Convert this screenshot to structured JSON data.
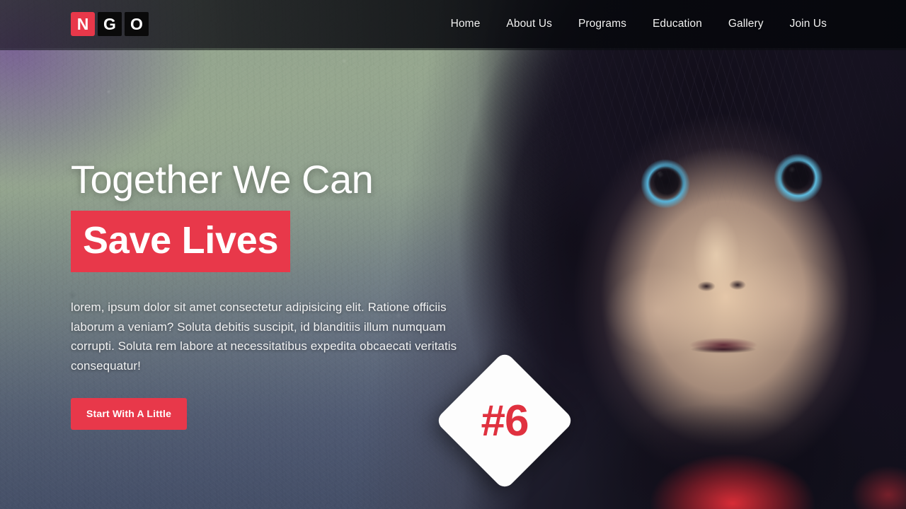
{
  "header": {
    "logo": {
      "name": "NGO",
      "tiles": [
        {
          "letter": "N",
          "style": "red"
        },
        {
          "letter": "G",
          "style": "black"
        },
        {
          "letter": "O",
          "style": "black"
        }
      ]
    },
    "nav": [
      {
        "label": "Home"
      },
      {
        "label": "About Us"
      },
      {
        "label": "Programs"
      },
      {
        "label": "Education"
      },
      {
        "label": "Gallery"
      },
      {
        "label": "Join Us"
      }
    ]
  },
  "hero": {
    "title_line1": "Together We Can",
    "title_line2": "Save Lives",
    "paragraph": "lorem, ipsum dolor sit amet consectetur adipisicing elit. Ratione officiis laborum a veniam? Soluta debitis suscipit, id blanditiis illum numquam corrupti. Soluta rem labore at necessitatibus expedita obcaecati veritatis consequatur!",
    "cta_label": "Start With A Little"
  },
  "badge": {
    "label": "#6"
  },
  "colors": {
    "accent_red": "#e8384a",
    "badge_red": "#e0313f",
    "logo_black": "#0a0a0a",
    "text_white": "#ffffff",
    "header_bg": "rgba(8,9,14,.92)"
  }
}
